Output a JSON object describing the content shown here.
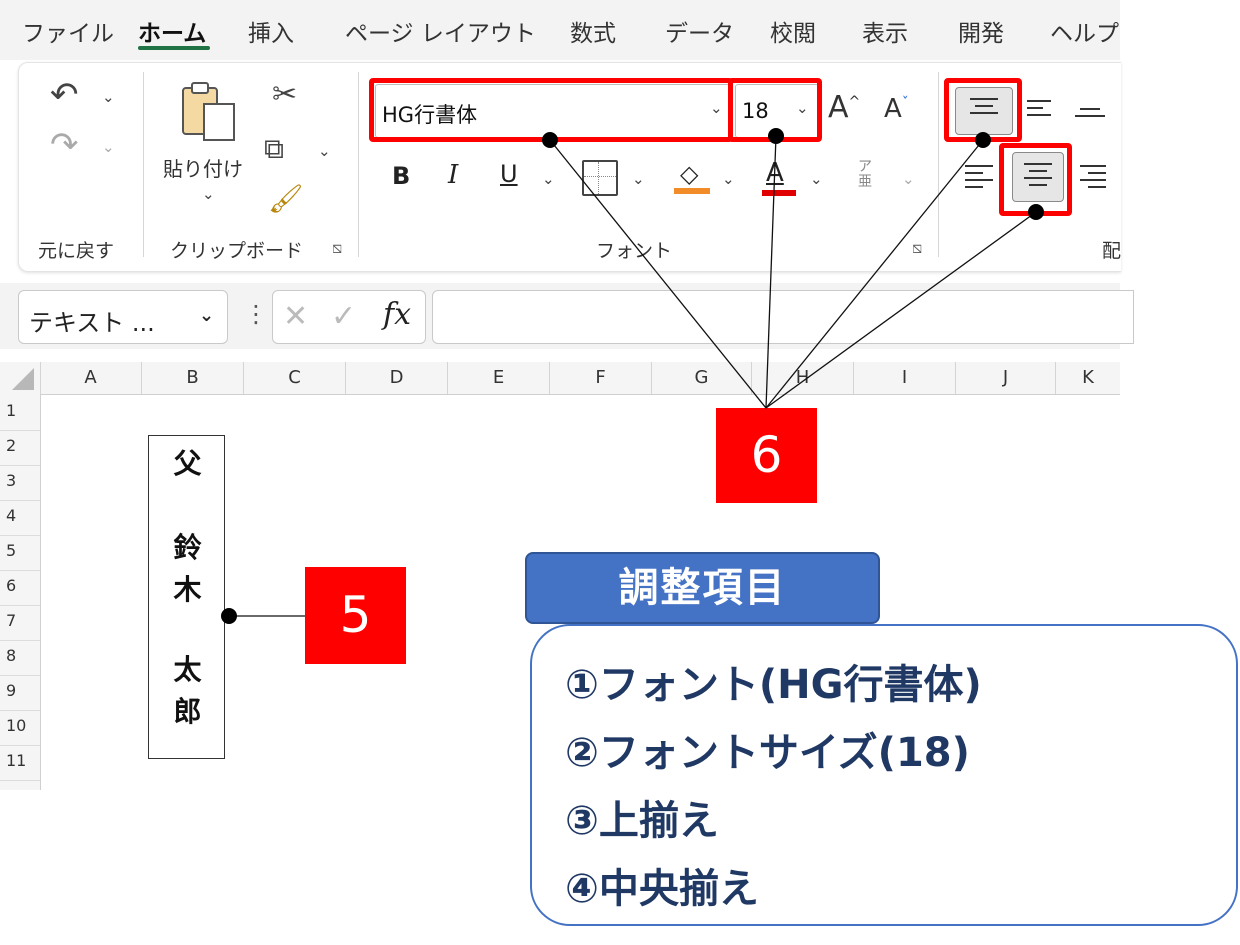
{
  "menu": {
    "tabs": [
      "ファイル",
      "ホーム",
      "挿入",
      "ページ レイアウト",
      "数式",
      "データ",
      "校閲",
      "表示",
      "開発",
      "ヘルプ"
    ],
    "active_tab": "ホーム"
  },
  "ribbon": {
    "undo_group_label": "元に戻す",
    "clipboard": {
      "paste_label": "貼り付け",
      "group_label": "クリップボード"
    },
    "font": {
      "font_name": "HG行書体",
      "font_size": "18",
      "group_label": "フォント",
      "bold": "B",
      "italic": "I",
      "underline": "U",
      "grow": "A",
      "shrink": "A",
      "phonetic": "ア亜",
      "font_color": "A"
    },
    "alignment": {
      "group_label_partial": "配"
    }
  },
  "formula_bar": {
    "name_box_value": "テキスト ...",
    "fx": "fx"
  },
  "grid": {
    "columns": [
      "A",
      "B",
      "C",
      "D",
      "E",
      "F",
      "G",
      "H",
      "I",
      "J",
      "K"
    ],
    "rows": [
      "1",
      "2",
      "3",
      "4",
      "5",
      "6",
      "7",
      "8",
      "9",
      "10",
      "11"
    ]
  },
  "name_card": {
    "chars": [
      "父",
      "鈴",
      "木",
      "太",
      "郎"
    ]
  },
  "callouts": {
    "five": "5",
    "six": "6"
  },
  "adjustment": {
    "title": "調整項目",
    "items": [
      "①フォント(HG行書体)",
      "②フォントサイズ(18)",
      "③上揃え",
      "④中央揃え"
    ]
  },
  "colors": {
    "highlight_red": "#ff0000",
    "accent_blue": "#4472c4",
    "text_navy": "#1f3864"
  }
}
